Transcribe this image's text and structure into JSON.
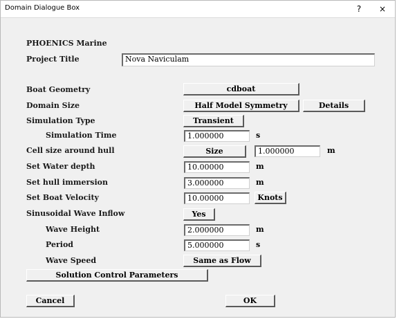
{
  "window": {
    "title": "Domain Dialogue Box",
    "help_glyph": "?",
    "close_glyph": "×"
  },
  "header": {
    "app_name": "PHOENICS Marine",
    "project_title_label": "Project Title",
    "project_title_value": "Nova Naviculam"
  },
  "rows": {
    "boat_geometry": {
      "label": "Boat Geometry",
      "button": "cdboat"
    },
    "domain_size": {
      "label": "Domain Size",
      "button": "Half Model Symmetry",
      "details_button": "Details"
    },
    "simulation_type": {
      "label": "Simulation Type",
      "button": "Transient"
    },
    "simulation_time": {
      "label": "Simulation Time",
      "value": "1.000000",
      "unit": "s"
    },
    "cell_size": {
      "label": "Cell size around hull",
      "button": "Size",
      "value": "1.000000",
      "unit": "m"
    },
    "water_depth": {
      "label": "Set Water depth",
      "value": "10.00000",
      "unit": "m"
    },
    "hull_immersion": {
      "label": "Set hull immersion",
      "value": "3.000000",
      "unit": "m"
    },
    "boat_velocity": {
      "label": "Set Boat Velocity",
      "value": "10.00000",
      "unit_button": "Knots"
    },
    "wave_inflow": {
      "label": "Sinusoidal Wave Inflow",
      "button": "Yes"
    },
    "wave_height": {
      "label": "Wave Height",
      "value": "2.000000",
      "unit": "m"
    },
    "period": {
      "label": "Period",
      "value": "5.000000",
      "unit": "s"
    },
    "wave_speed": {
      "label": "Wave Speed",
      "button": "Same as Flow"
    }
  },
  "footer": {
    "solution_control_button": "Solution Control Parameters",
    "cancel_button": "Cancel",
    "ok_button": "OK"
  },
  "colors": {
    "dialog_bg": "#f0f0f0",
    "accent": "#1e73b8",
    "field_bg": "#ffffff"
  }
}
